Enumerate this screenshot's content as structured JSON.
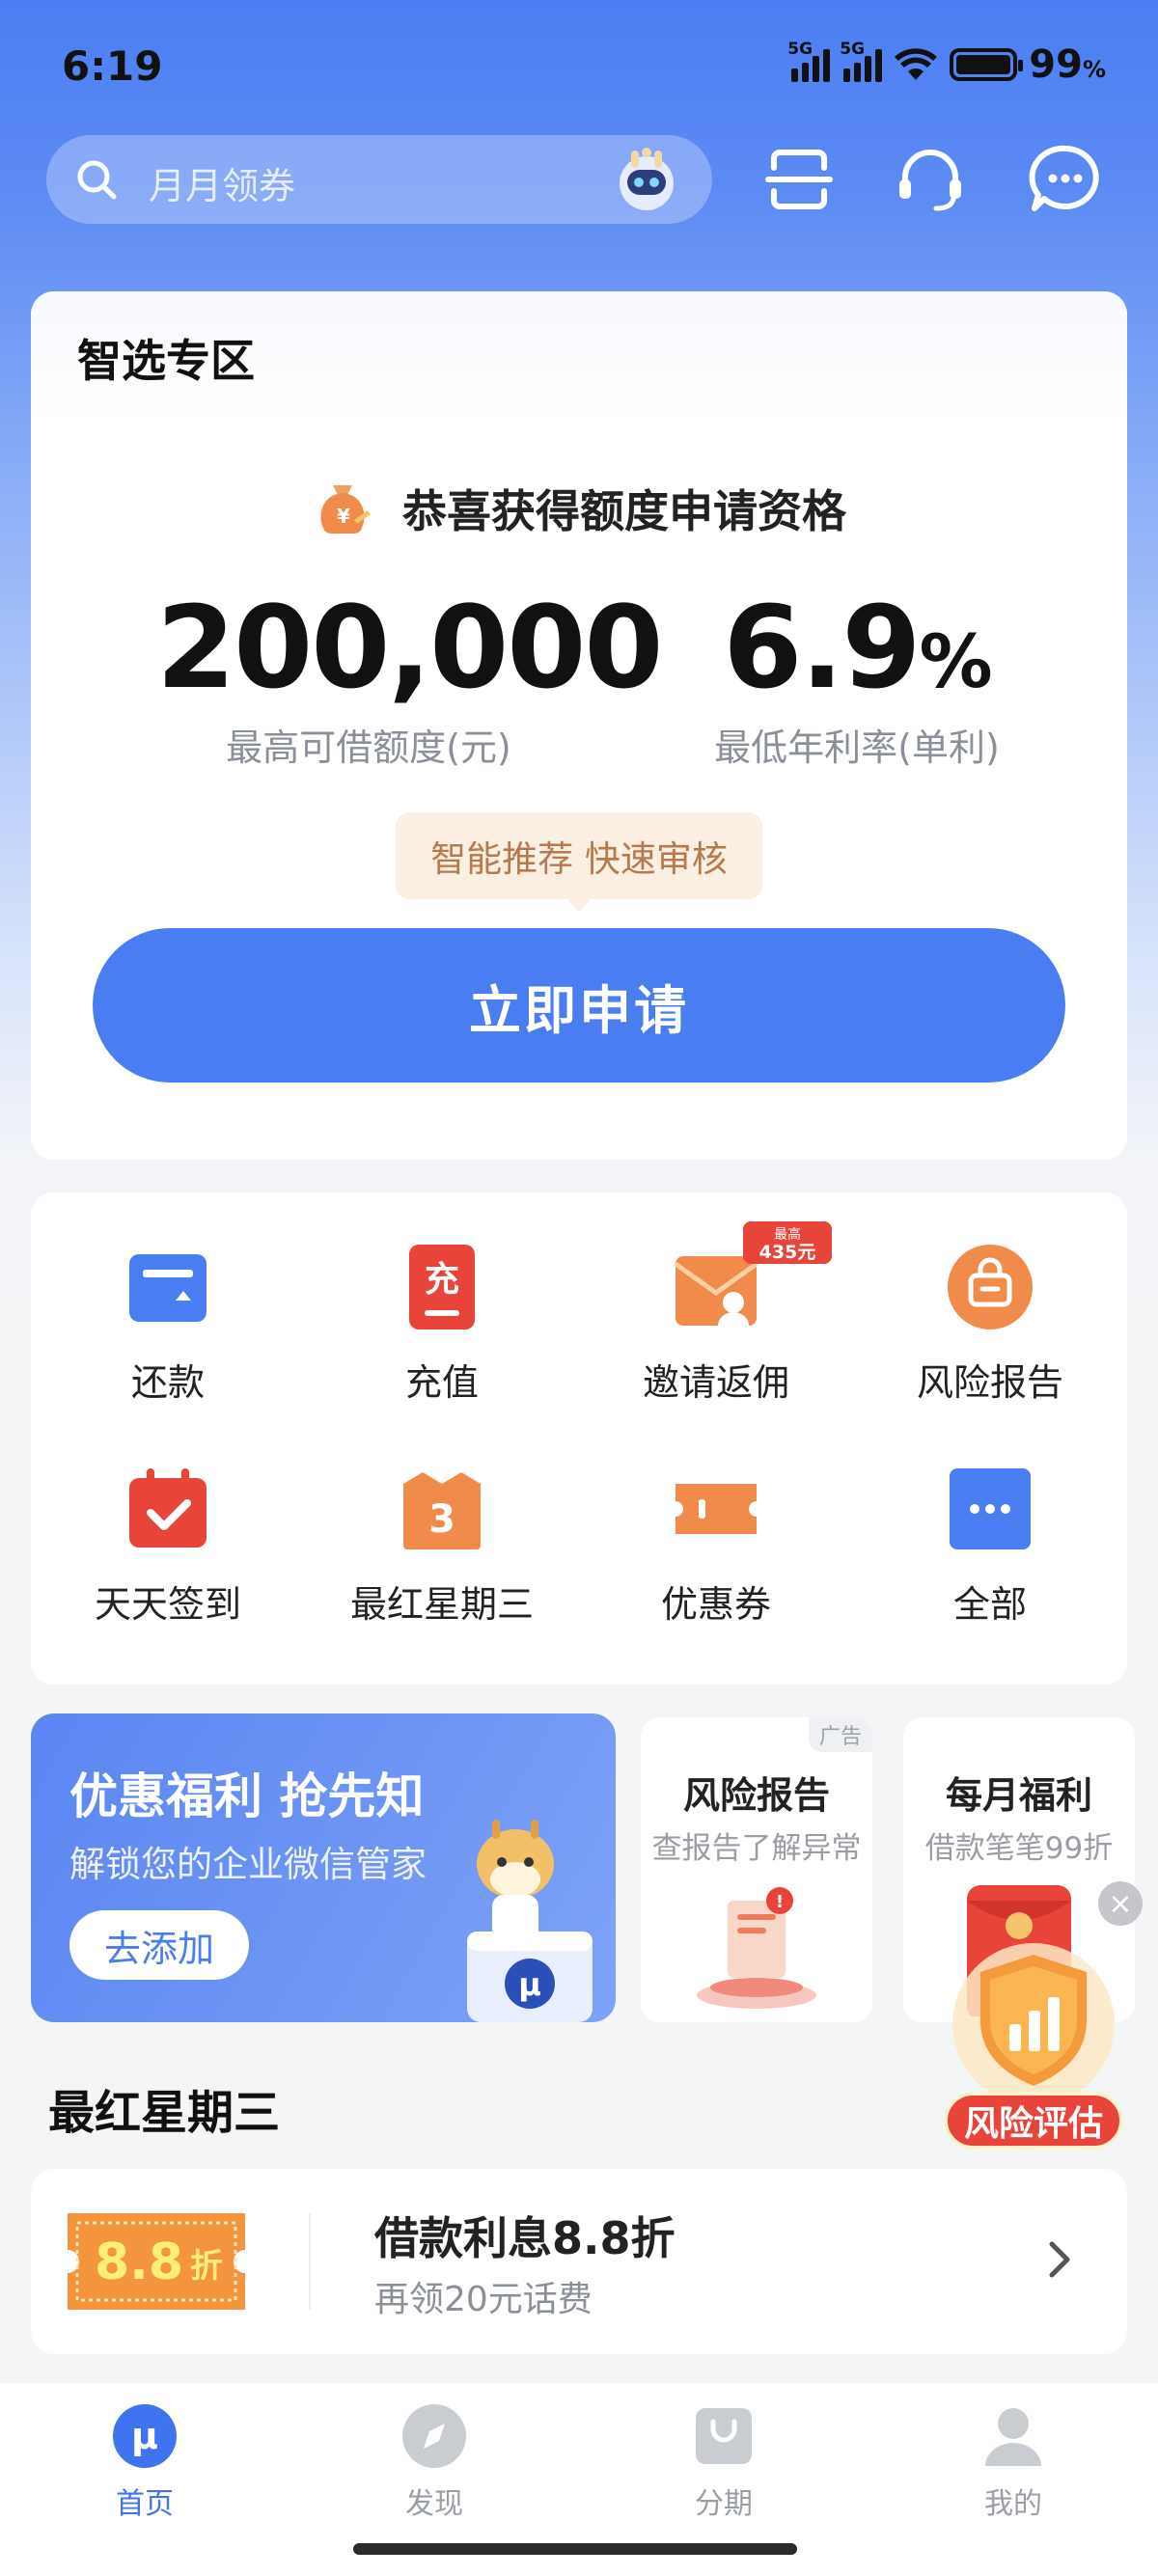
{
  "status": {
    "time": "6:19",
    "signal1": "5G",
    "signal2": "5G",
    "battery": "99",
    "battery_unit": "%"
  },
  "search": {
    "placeholder": "月月领券"
  },
  "card_main": {
    "title": "智选专区",
    "congrats": "恭喜获得额度申请资格",
    "limit_value": "200,000",
    "limit_label": "最高可借额度(元)",
    "rate_value": "6.9",
    "rate_unit": "%",
    "rate_label": "最低年利率(单利)",
    "tip": "智能推荐 快速审核",
    "apply_button": "立即申请"
  },
  "grid": {
    "items": [
      {
        "label": "还款",
        "icon": "repay-icon"
      },
      {
        "label": "充值",
        "icon": "recharge-icon",
        "glyph": "充"
      },
      {
        "label": "邀请返佣",
        "icon": "invite-icon",
        "badge_top": "最高",
        "badge_bottom": "435元"
      },
      {
        "label": "风险报告",
        "icon": "risk-report-icon"
      },
      {
        "label": "天天签到",
        "icon": "checkin-icon"
      },
      {
        "label": "最红星期三",
        "icon": "wednesday-icon",
        "glyph": "3"
      },
      {
        "label": "优惠券",
        "icon": "coupon-icon"
      },
      {
        "label": "全部",
        "icon": "more-icon"
      }
    ]
  },
  "banner": {
    "title": "优惠福利 抢先知",
    "subtitle": "解锁您的企业微信管家",
    "button": "去添加",
    "badge": "μ"
  },
  "mini_cards": [
    {
      "title": "风险报告",
      "subtitle": "查报告了解异常",
      "ad": "广告"
    },
    {
      "title": "每月福利",
      "subtitle": "借款笔笔99折"
    }
  ],
  "float": {
    "label": "风险评估",
    "close": "×"
  },
  "section": {
    "title": "最红星期三"
  },
  "promo": {
    "coupon_value": "8.8",
    "coupon_unit": "折",
    "title": "借款利息8.8折",
    "subtitle": "再领20元话费"
  },
  "tabs": [
    {
      "label": "首页",
      "active": true
    },
    {
      "label": "发现",
      "active": false
    },
    {
      "label": "分期",
      "active": false
    },
    {
      "label": "我的",
      "active": false
    }
  ],
  "colors": {
    "primary": "#4a7cf2",
    "accent_orange": "#f08b4b",
    "accent_red": "#e8443a"
  }
}
